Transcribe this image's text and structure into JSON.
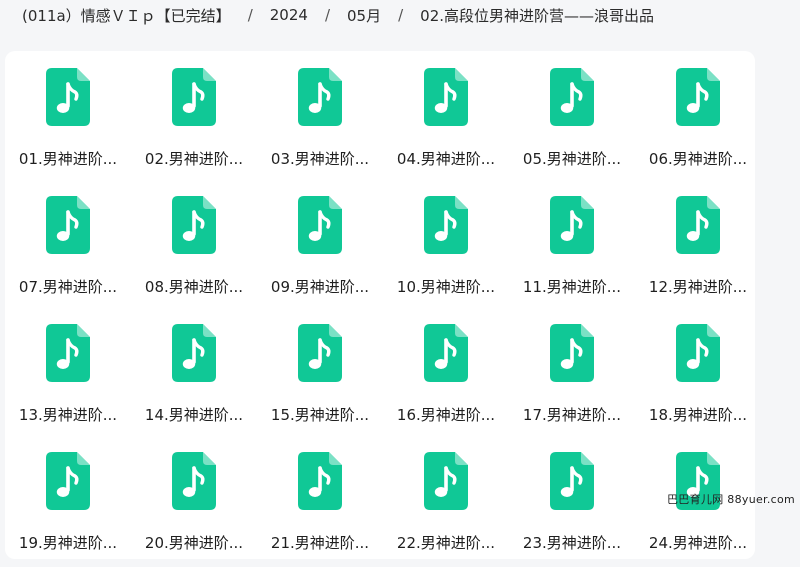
{
  "breadcrumb": [
    "(011a）情感ＶＩｐ【已完结】",
    "2024",
    "05月",
    "02.高段位男神进阶营——浪哥出品"
  ],
  "breadcrumb_separator": "/",
  "icon_color": "#10c896",
  "files": [
    "01.男神进阶...",
    "02.男神进阶...",
    "03.男神进阶...",
    "04.男神进阶...",
    "05.男神进阶...",
    "06.男神进阶...",
    "07.男神进阶...",
    "08.男神进阶...",
    "09.男神进阶...",
    "10.男神进阶...",
    "11.男神进阶...",
    "12.男神进阶...",
    "13.男神进阶...",
    "14.男神进阶...",
    "15.男神进阶...",
    "16.男神进阶...",
    "17.男神进阶...",
    "18.男神进阶...",
    "19.男神进阶...",
    "20.男神进阶...",
    "21.男神进阶...",
    "22.男神进阶...",
    "23.男神进阶...",
    "24.男神进阶..."
  ],
  "watermark": "巴巴育儿网 88yuer.com"
}
